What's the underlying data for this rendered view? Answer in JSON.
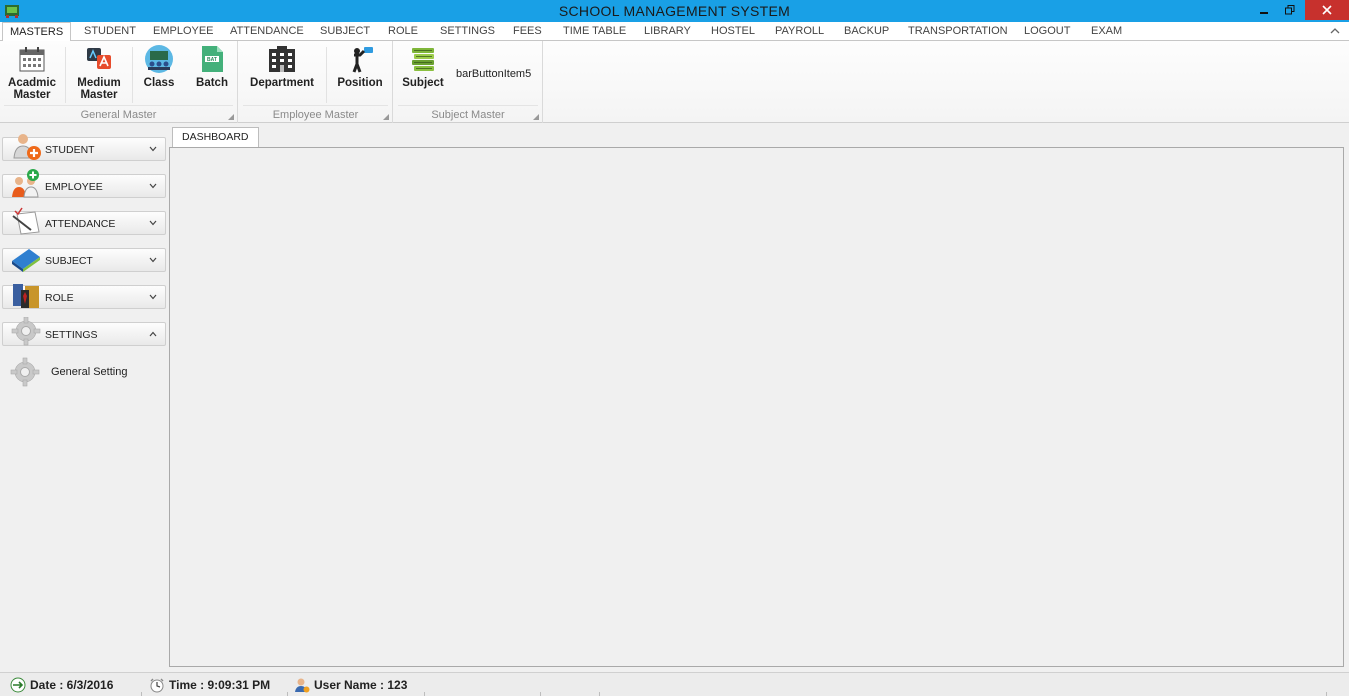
{
  "window": {
    "title": "SCHOOL MANAGEMENT SYSTEM"
  },
  "tabs": [
    {
      "label": "MASTERS",
      "active": true
    },
    {
      "label": "STUDENT"
    },
    {
      "label": "EMPLOYEE"
    },
    {
      "label": "ATTENDANCE"
    },
    {
      "label": "SUBJECT"
    },
    {
      "label": "ROLE"
    },
    {
      "label": "SETTINGS"
    },
    {
      "label": "FEES"
    },
    {
      "label": "TIME TABLE"
    },
    {
      "label": "LIBRARY"
    },
    {
      "label": "HOSTEL"
    },
    {
      "label": "PAYROLL"
    },
    {
      "label": "BACKUP"
    },
    {
      "label": "TRANSPORTATION"
    },
    {
      "label": "LOGOUT"
    },
    {
      "label": "EXAM"
    }
  ],
  "ribbon": {
    "general_master": {
      "caption": "General Master",
      "acadmic_line1": "Acadmic",
      "acadmic_line2": "Master",
      "medium_line1": "Medium",
      "medium_line2": "Master",
      "class_label": "Class",
      "batch_label": "Batch",
      "batch_icon_text": "BAT"
    },
    "employee_master": {
      "caption": "Employee Master",
      "department_label": "Department",
      "position_label": "Position"
    },
    "subject_master": {
      "caption": "Subject Master",
      "subject_label": "Subject",
      "bar_item_label": "barButtonItem5"
    }
  },
  "nav": {
    "groups": [
      {
        "label": "STUDENT",
        "expanded": false
      },
      {
        "label": "EMPLOYEE",
        "expanded": false
      },
      {
        "label": "ATTENDANCE",
        "expanded": false
      },
      {
        "label": "SUBJECT",
        "expanded": false
      },
      {
        "label": "ROLE",
        "expanded": false
      },
      {
        "label": "SETTINGS",
        "expanded": true
      }
    ],
    "settings_items": [
      {
        "label": "General Setting"
      }
    ]
  },
  "document": {
    "tab_label": "DASHBOARD"
  },
  "status": {
    "date": "Date : 6/3/2016",
    "time": "Time : 9:09:31 PM",
    "user": "User Name : 123"
  },
  "colors": {
    "titlebar": "#19a0e6",
    "close_button": "#c7312d"
  }
}
